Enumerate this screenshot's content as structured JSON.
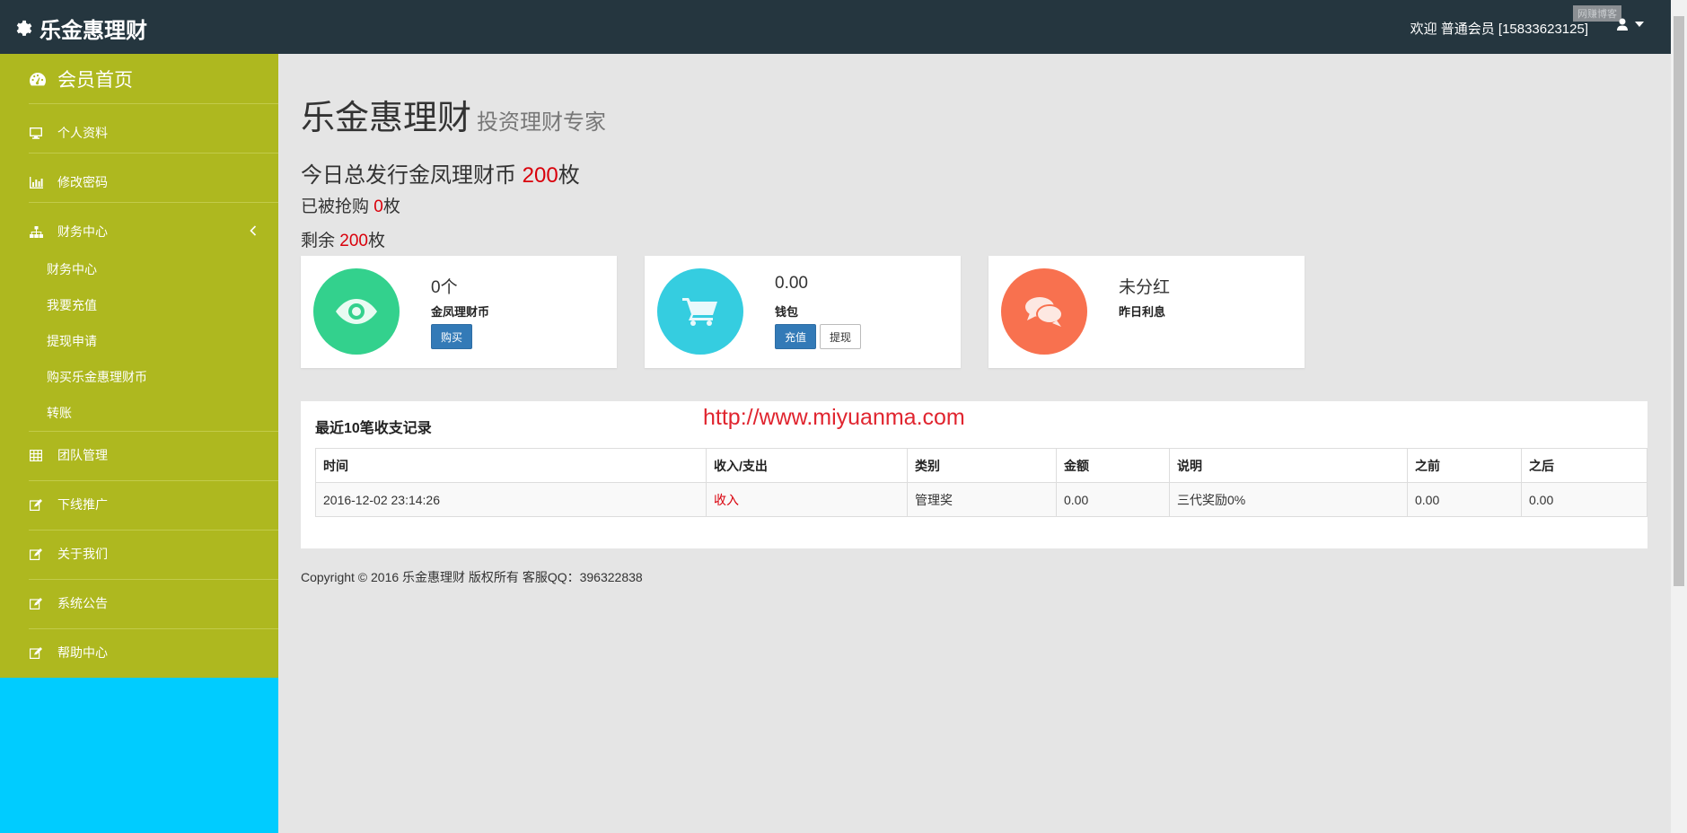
{
  "header": {
    "brand": "乐金惠理财",
    "welcome": "欢迎 普通会员 [15833623125]",
    "watermark": "网赚博客"
  },
  "sidebar": {
    "items": [
      {
        "label": "会员首页",
        "icon": "dashboard-icon"
      },
      {
        "label": "个人资料",
        "icon": "desktop-icon"
      },
      {
        "label": "修改密码",
        "icon": "bar-chart-icon"
      },
      {
        "label": "财务中心",
        "icon": "sitemap-icon"
      },
      {
        "label": "团队管理",
        "icon": "table-icon"
      },
      {
        "label": "下线推广",
        "icon": "edit-icon"
      },
      {
        "label": "关于我们",
        "icon": "edit-icon"
      },
      {
        "label": "系统公告",
        "icon": "edit-icon"
      },
      {
        "label": "帮助中心",
        "icon": "edit-icon"
      }
    ],
    "finance_sub": [
      "财务中心",
      "我要充值",
      "提现申请",
      "购买乐金惠理财币",
      "转账"
    ]
  },
  "main": {
    "title": "乐金惠理财",
    "subtitle": "投资理财专家",
    "stat1_prefix": "今日总发行金凤理财币 ",
    "stat1_value": "200",
    "stat1_suffix": "枚",
    "stat2_prefix": "已被抢购 ",
    "stat2_value": "0",
    "stat2_suffix": "枚",
    "stat3_prefix": "剩余 ",
    "stat3_value": "200",
    "stat3_suffix": "枚"
  },
  "cards": [
    {
      "value": "0个",
      "label": "金凤理财币",
      "buttons": [
        "购买"
      ],
      "color": "#33d18d",
      "icon": "eye-icon"
    },
    {
      "value": "0.00",
      "label": "钱包",
      "buttons": [
        "充值",
        "提现"
      ],
      "color": "#35cde0",
      "icon": "cart-icon"
    },
    {
      "value": "未分红",
      "label": "昨日利息",
      "buttons": [],
      "color": "#f8714f",
      "icon": "comments-icon"
    }
  ],
  "records": {
    "title": "最近10笔收支记录",
    "watermark_url": "http://www.miyuanma.com",
    "columns": [
      "时间",
      "收入/支出",
      "类别",
      "金额",
      "说明",
      "之前",
      "之后"
    ],
    "rows": [
      [
        "2016-12-02 23:14:26",
        "收入",
        "管理奖",
        "0.00",
        "三代奖励0%",
        "0.00",
        "0.00"
      ]
    ]
  },
  "footer": {
    "copyright": "Copyright © 2016 乐金惠理财 版权所有 客服QQ：396322838"
  },
  "colors": {
    "topbar": "#25363f",
    "sidebar": "#aeb81f",
    "sidebar_bottom": "#00ccff",
    "accent_red": "#d9000b"
  }
}
